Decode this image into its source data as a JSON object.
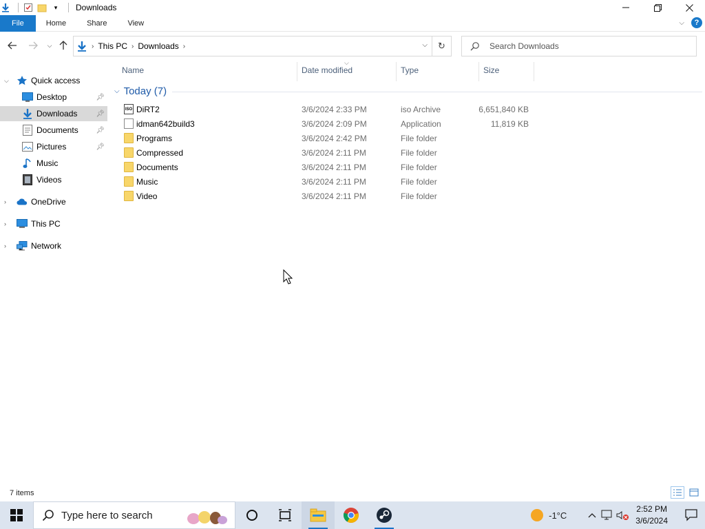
{
  "window": {
    "title": "Downloads",
    "caption": {
      "minimize": "—",
      "restore": "❐",
      "close": "✕"
    }
  },
  "ribbon": {
    "tabs": [
      "File",
      "Home",
      "Share",
      "View"
    ],
    "help": "?"
  },
  "address": {
    "breadcrumb": [
      "This PC",
      "Downloads"
    ],
    "search_placeholder": "Search Downloads"
  },
  "nav": {
    "items": [
      {
        "label": "Quick access",
        "icon": "star-icon",
        "level": 0,
        "expanded": true
      },
      {
        "label": "Desktop",
        "icon": "desktop-icon",
        "level": 1,
        "pinned": true
      },
      {
        "label": "Downloads",
        "icon": "download-arrow-icon",
        "level": 1,
        "pinned": true,
        "selected": true
      },
      {
        "label": "Documents",
        "icon": "documents-icon",
        "level": 1,
        "pinned": true
      },
      {
        "label": "Pictures",
        "icon": "pictures-icon",
        "level": 1,
        "pinned": true
      },
      {
        "label": "Music",
        "icon": "music-note-icon",
        "level": 1
      },
      {
        "label": "Videos",
        "icon": "videos-icon",
        "level": 1
      },
      {
        "label": "OneDrive",
        "icon": "cloud-icon",
        "level": 0
      },
      {
        "label": "This PC",
        "icon": "computer-icon",
        "level": 0
      },
      {
        "label": "Network",
        "icon": "network-icon",
        "level": 0
      }
    ]
  },
  "columns": [
    "Name",
    "Date modified",
    "Type",
    "Size"
  ],
  "group": {
    "label": "Today (7)"
  },
  "files": [
    {
      "name": "DiRT2",
      "date": "3/6/2024 2:33 PM",
      "type": "iso Archive",
      "size": "6,651,840 KB",
      "icon": "iso-file-icon"
    },
    {
      "name": "idman642build3",
      "date": "3/6/2024 2:09 PM",
      "type": "Application",
      "size": "11,819 KB",
      "icon": "application-file-icon"
    },
    {
      "name": "Programs",
      "date": "3/6/2024 2:42 PM",
      "type": "File folder",
      "size": "",
      "icon": "folder-icon"
    },
    {
      "name": "Compressed",
      "date": "3/6/2024 2:11 PM",
      "type": "File folder",
      "size": "",
      "icon": "folder-icon"
    },
    {
      "name": "Documents",
      "date": "3/6/2024 2:11 PM",
      "type": "File folder",
      "size": "",
      "icon": "folder-icon"
    },
    {
      "name": "Music",
      "date": "3/6/2024 2:11 PM",
      "type": "File folder",
      "size": "",
      "icon": "folder-icon"
    },
    {
      "name": "Video",
      "date": "3/6/2024 2:11 PM",
      "type": "File folder",
      "size": "",
      "icon": "folder-icon"
    }
  ],
  "status": {
    "item_count": "7 items"
  },
  "taskbar": {
    "search_placeholder": "Type here to search",
    "weather": "-1°C",
    "time": "2:52 PM",
    "date": "3/6/2024"
  },
  "colors": {
    "accent": "#1979ca",
    "group_header": "#1e5aa8",
    "selected_nav": "#d9d9d9",
    "taskbar": "#dce4ef"
  }
}
